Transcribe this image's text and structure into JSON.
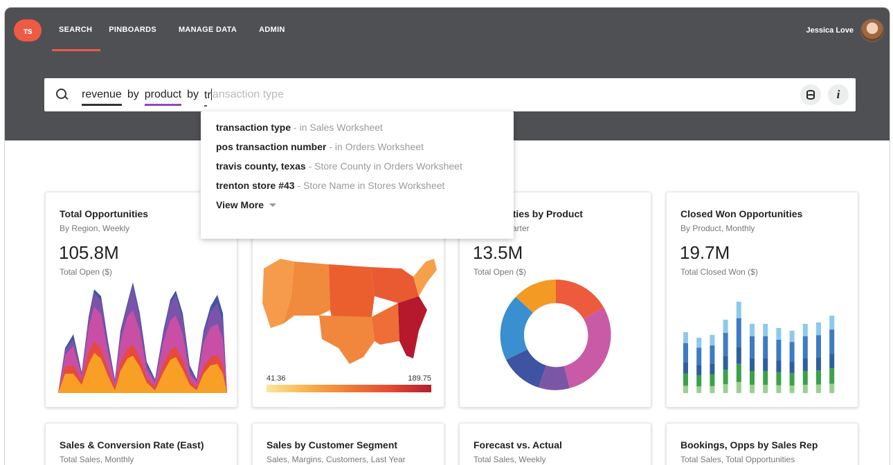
{
  "app": {
    "logo_text": "ᴛs"
  },
  "nav": {
    "items": [
      {
        "label": "SEARCH",
        "active": true
      },
      {
        "label": "PINBOARDS",
        "active": false
      },
      {
        "label": "MANAGE DATA",
        "active": false
      },
      {
        "label": "ADMIN",
        "active": false
      }
    ]
  },
  "user": {
    "name": "Jessica Love"
  },
  "search": {
    "tokens": [
      "revenue",
      "by",
      "product",
      "by"
    ],
    "typed": "tr",
    "ghost": "ansaction type"
  },
  "suggestions": {
    "items": [
      {
        "term": "transaction type",
        "hint": " - in Sales Worksheet"
      },
      {
        "term": "pos transaction number",
        "hint": " - in Orders Worksheet"
      },
      {
        "term": "travis county, texas",
        "hint": " - Store County in Orders Worksheet"
      },
      {
        "term": "trenton store #43",
        "hint": " - Store Name in Stores Worksheet"
      }
    ],
    "view_more": "View More"
  },
  "cards": [
    {
      "title": "Total Opportunities",
      "subtitle": "By Region, Weekly",
      "value": "105.8M",
      "value_label": "Total Open ($)"
    },
    {
      "title": "",
      "subtitle": "",
      "value": "",
      "value_label": "",
      "legend_min": "41.36",
      "legend_max": "189.75"
    },
    {
      "title": "pportunities by Product",
      "subtitle": "Quarter",
      "value": "13.5M",
      "value_label": "Total Open ($)"
    },
    {
      "title": "Closed Won Opportunities",
      "subtitle": "By Product, Monthly",
      "value": "19.7M",
      "value_label": "Total Closed Won ($)"
    }
  ],
  "cards_row2": [
    {
      "title": "Sales & Conversion Rate (East)",
      "subtitle": "Total Sales, Monthly"
    },
    {
      "title": "Sales by Customer Segment",
      "subtitle": "Sales, Margins, Customers, Last Year"
    },
    {
      "title": "Forecast vs. Actual",
      "subtitle": "Total Sales, Weekly"
    },
    {
      "title": "Bookings, Opps by Sales Rep",
      "subtitle": "Total Sales, Total Opportunities"
    }
  ],
  "colors": {
    "accent": "#ef5a45",
    "header_bg": "#4f5053",
    "token_product_underline": "#8a4bbd"
  },
  "icons": [
    "search-icon",
    "database-icon",
    "info-icon",
    "chevron-down-icon"
  ]
}
